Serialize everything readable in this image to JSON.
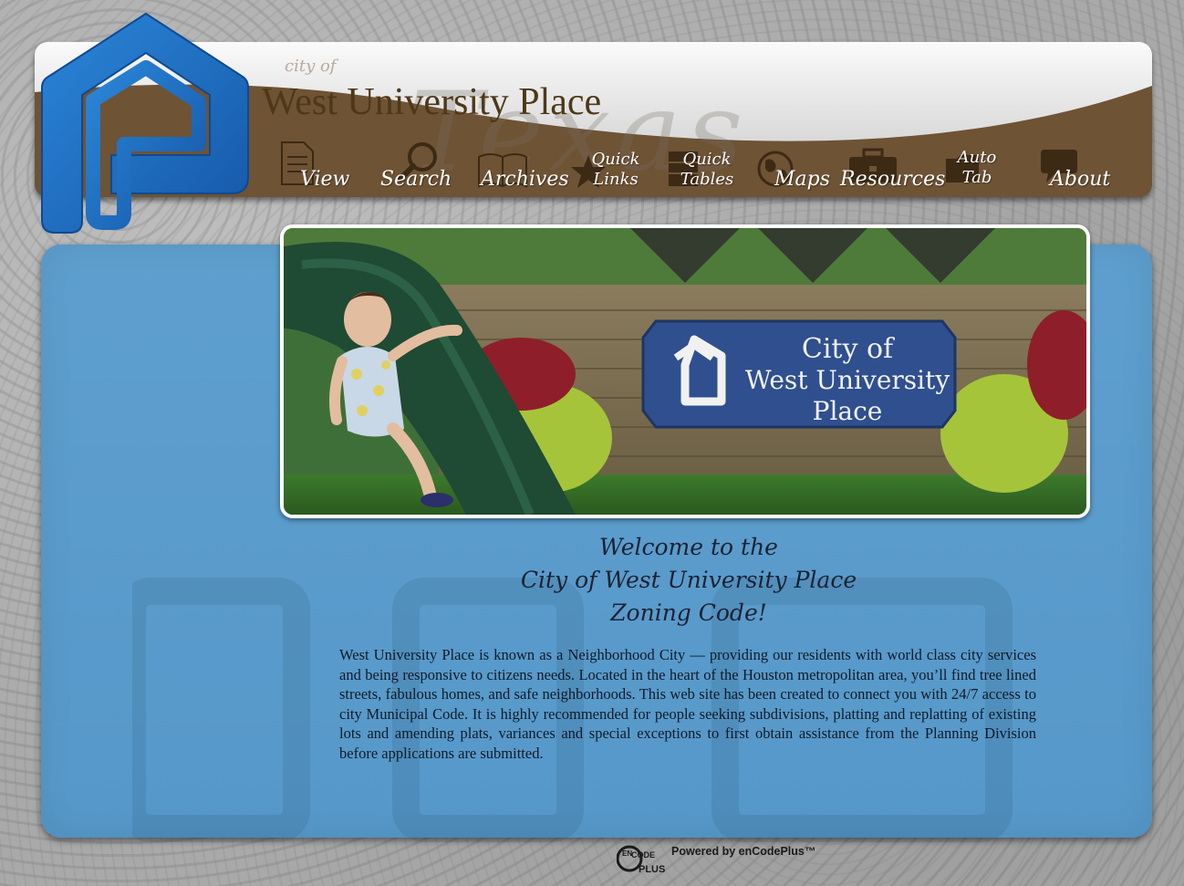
{
  "header": {
    "city_of": "city of",
    "title": "West University Place",
    "watermark": "Texas"
  },
  "nav": {
    "items": [
      {
        "label": "View",
        "icon": "document-icon"
      },
      {
        "label": "Search",
        "icon": "magnifier-icon"
      },
      {
        "label": "Archives",
        "icon": "book-icon"
      },
      {
        "label_line1": "Quick",
        "label_line2": "Links",
        "icon": "star-icon"
      },
      {
        "label_line1": "Quick",
        "label_line2": "Tables",
        "icon": "table-icon"
      },
      {
        "label": "Maps",
        "icon": "globe-icon"
      },
      {
        "label": "Resources",
        "icon": "briefcase-icon"
      },
      {
        "label_line1": "Auto",
        "label_line2": "Tab",
        "icon": "folder-icon"
      },
      {
        "label": "About",
        "icon": "speech-bubble-icon"
      }
    ]
  },
  "hero": {
    "sign_line1": "City of",
    "sign_line2": "West University",
    "sign_line3": "Place"
  },
  "welcome": {
    "line1": "Welcome to the",
    "line2": "City of West University Place",
    "line3": "Zoning Code!"
  },
  "intro": {
    "text": "West University Place is known as a Neighborhood City — providing our residents with world class city services and being responsive to citizens needs. Located in the heart of the Houston metropolitan area, you’ll find tree lined streets, fabulous homes, and safe neighborhoods. This web site has been created to connect you with 24/7 access to city Municipal Code.  It is highly recommended for people seeking subdivisions, platting and replatting of existing lots and amending plats, variances and special exceptions to first obtain assistance from the Planning Division before applications are submitted."
  },
  "footer": {
    "badge_line1": "EN",
    "badge_line2": "CODE",
    "badge_line3": "PLUS",
    "powered_by": "Powered by enCodePlus™"
  },
  "colors": {
    "brand_blue": "#1f72c4",
    "header_brown": "#6e5335",
    "panel_blue": "#5e9fcf",
    "title_brown": "#4e3817"
  }
}
